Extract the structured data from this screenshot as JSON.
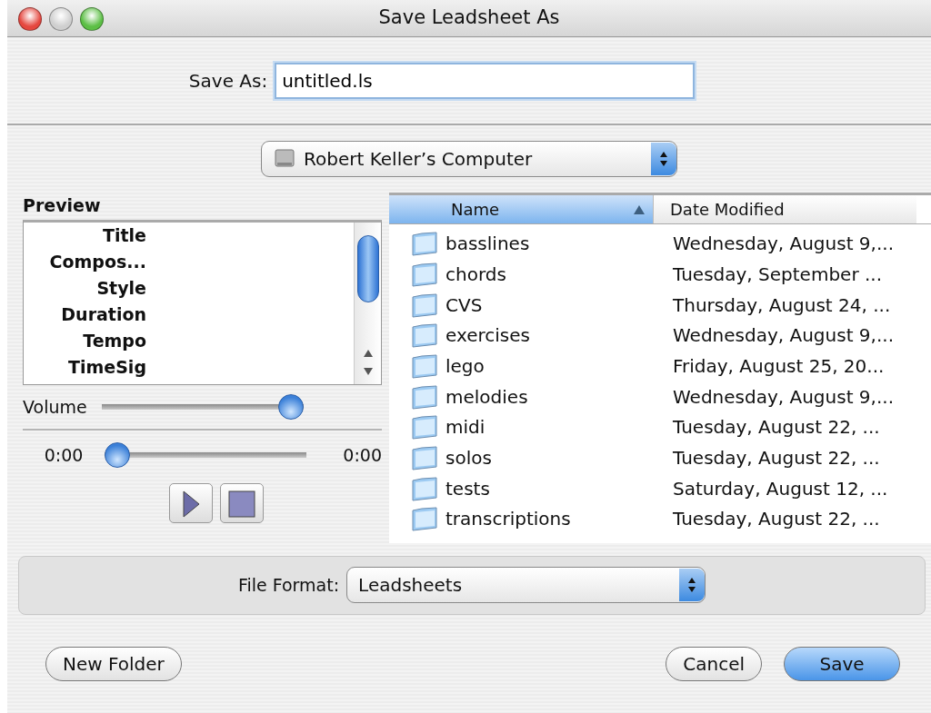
{
  "window": {
    "title": "Save Leadsheet As",
    "controls": [
      {
        "color": "#e5473f"
      },
      {
        "color": "#cfcfcf"
      },
      {
        "color": "#5cbf45"
      }
    ]
  },
  "save_as": {
    "label": "Save As:",
    "value": "untitled.ls"
  },
  "location": {
    "value": "Robert Keller’s Computer"
  },
  "preview": {
    "title": "Preview",
    "fields": [
      "Title",
      "Compos...",
      "Style",
      "Duration",
      "Tempo",
      "TimeSig"
    ],
    "volume": {
      "label": "Volume",
      "level": 1.0
    },
    "playback": {
      "start": "0:00",
      "end": "0:00",
      "level": 0
    }
  },
  "file_list": {
    "columns": [
      {
        "label": "Name",
        "sorted": true
      },
      {
        "label": "Date Modified",
        "sorted": false
      }
    ],
    "rows": [
      {
        "name": "basslines",
        "date": "Wednesday, August 9,..."
      },
      {
        "name": "chords",
        "date": "Tuesday, September ..."
      },
      {
        "name": "CVS",
        "date": "Thursday, August 24, ..."
      },
      {
        "name": "exercises",
        "date": "Wednesday, August 9,..."
      },
      {
        "name": "lego",
        "date": "Friday, August 25, 20..."
      },
      {
        "name": "melodies",
        "date": "Wednesday, August 9,..."
      },
      {
        "name": "midi",
        "date": "Tuesday, August 22, ..."
      },
      {
        "name": "solos",
        "date": "Tuesday, August 22, ..."
      },
      {
        "name": "tests",
        "date": "Saturday, August 12, ..."
      },
      {
        "name": "transcriptions",
        "date": "Tuesday, August 22, ..."
      }
    ]
  },
  "file_format": {
    "label": "File Format:",
    "value": "Leadsheets"
  },
  "buttons": [
    {
      "label": "New Folder",
      "kind": "plain"
    },
    {
      "label": "Cancel",
      "kind": "plain"
    },
    {
      "label": "Save",
      "kind": "default"
    }
  ]
}
